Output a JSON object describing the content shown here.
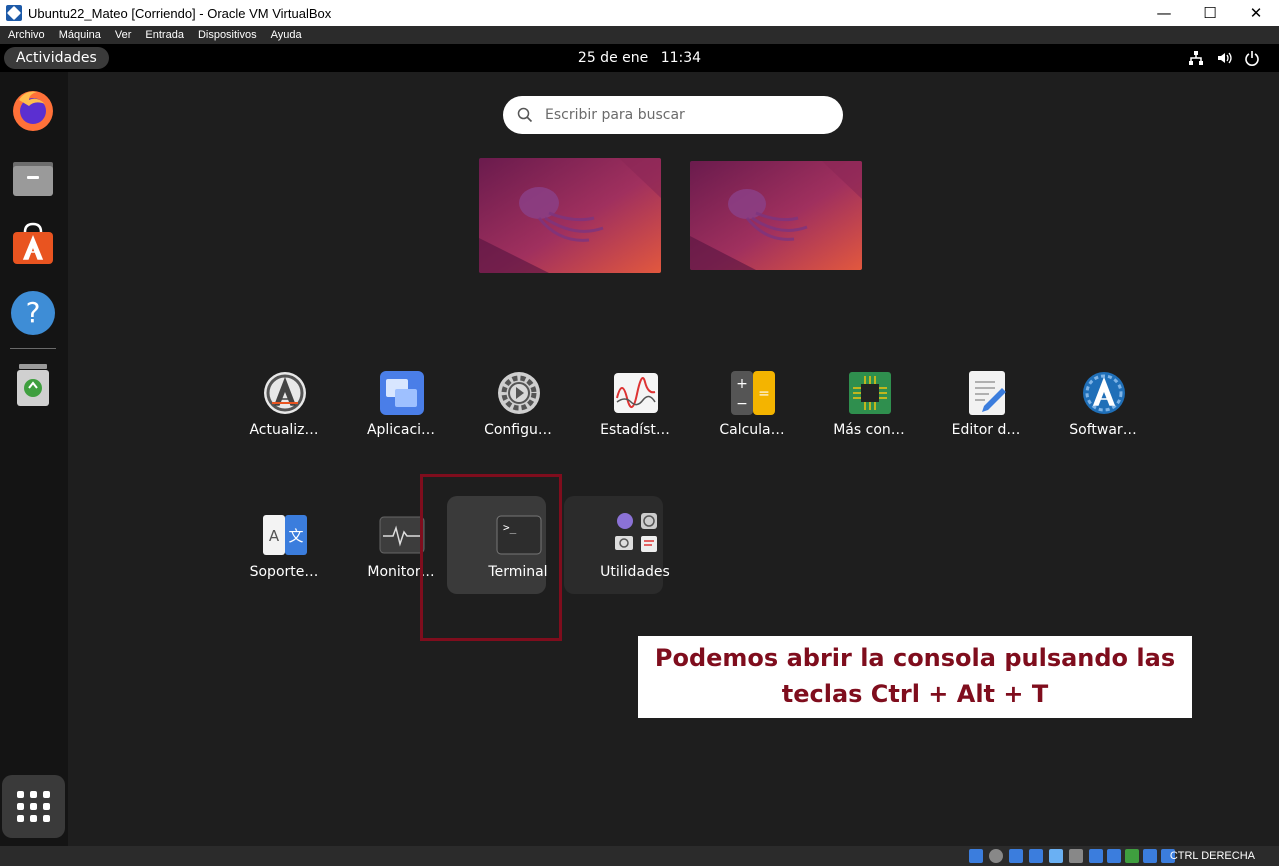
{
  "window": {
    "title": "Ubuntu22_Mateo [Corriendo] - Oracle VM VirtualBox",
    "controls": {
      "minimize": "—",
      "maximize": "☐",
      "close": "✕"
    }
  },
  "vbox_menu": [
    "Archivo",
    "Máquina",
    "Ver",
    "Entrada",
    "Dispositivos",
    "Ayuda"
  ],
  "gnome_topbar": {
    "activities": "Actividades",
    "date": "25 de ene",
    "time": "11:34",
    "tray_icons": [
      "network-icon",
      "volume-icon",
      "power-icon"
    ]
  },
  "dock": {
    "apps": [
      "Firefox",
      "Archivos",
      "Ubuntu Software",
      "Ayuda",
      "Papelera"
    ],
    "show_apps_icon": "grid-icon"
  },
  "search": {
    "placeholder": "Escribir para buscar"
  },
  "apps_row1": [
    {
      "label": "Actualiz…",
      "icon": "software-updater-icon"
    },
    {
      "label": "Aplicaci…",
      "icon": "startup-apps-icon"
    },
    {
      "label": "Configu…",
      "icon": "settings-gear-icon"
    },
    {
      "label": "Estadíst…",
      "icon": "power-stats-icon"
    },
    {
      "label": "Calcula…",
      "icon": "calculator-icon"
    },
    {
      "label": "Más con…",
      "icon": "additional-drivers-icon"
    },
    {
      "label": "Editor d…",
      "icon": "text-editor-icon"
    },
    {
      "label": "Softwar…",
      "icon": "software-properties-icon"
    }
  ],
  "apps_row2": [
    {
      "label": "Soporte…",
      "icon": "language-support-icon"
    },
    {
      "label": "Monitor…",
      "icon": "system-monitor-icon"
    },
    {
      "label": "Terminal",
      "icon": "terminal-icon"
    },
    {
      "label": "Utilidades",
      "icon": "utilities-folder-icon"
    }
  ],
  "annotation": {
    "line1": "Podemos abrir la consola pulsando las",
    "line2": "teclas Ctrl + Alt + T",
    "color": "#7f0d1d"
  },
  "statusbar": {
    "host_key": "CTRL DERECHA"
  }
}
